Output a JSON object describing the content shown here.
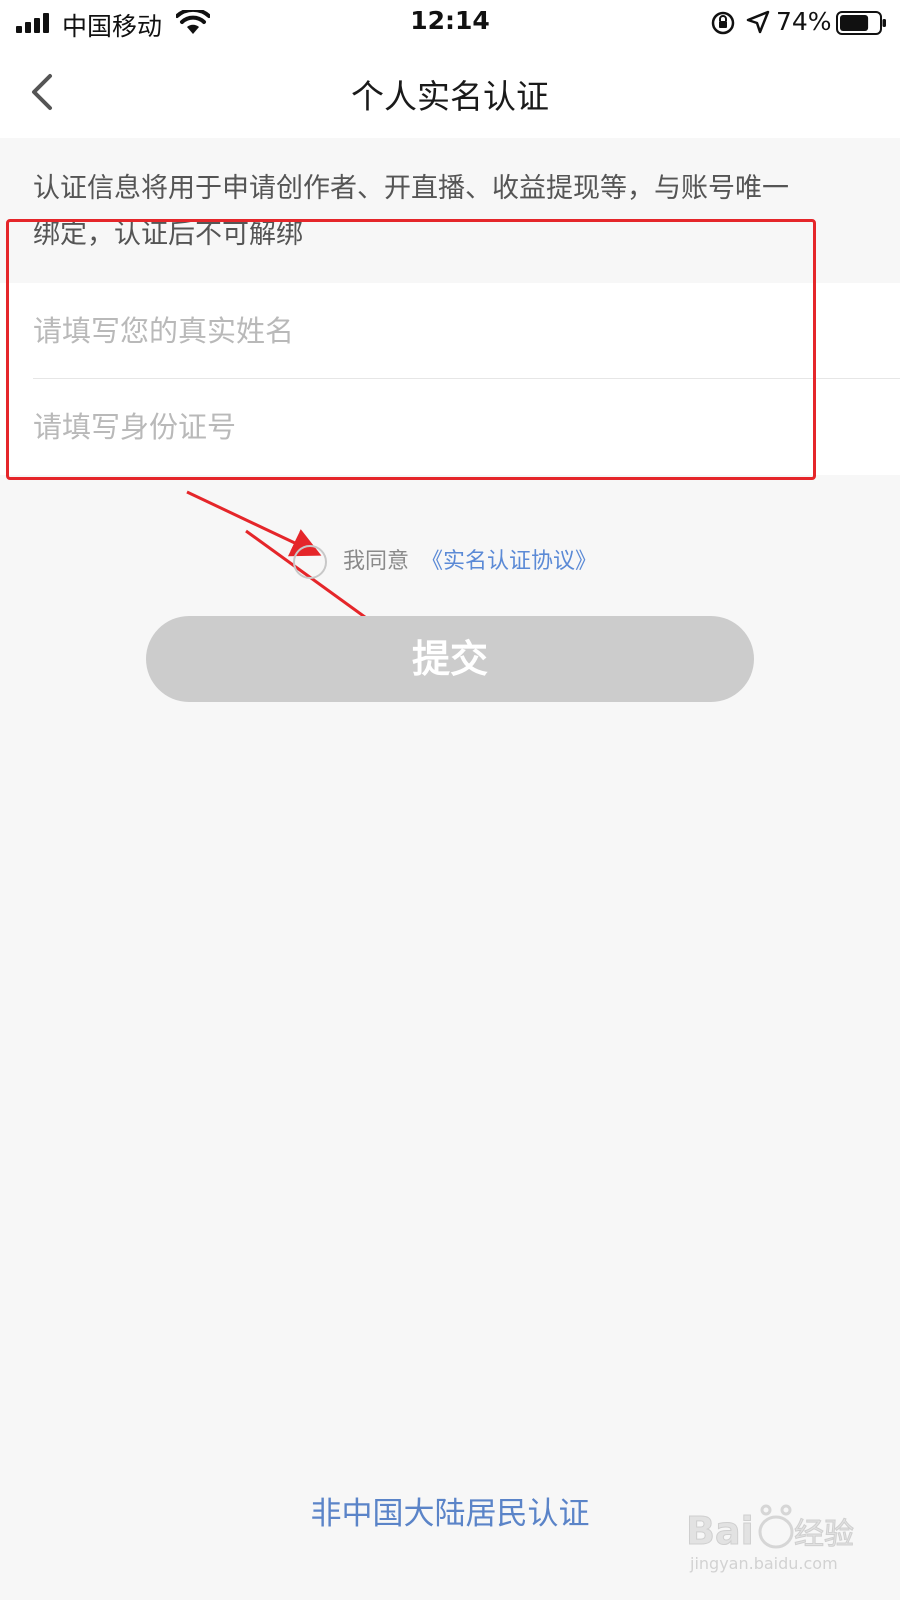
{
  "status_bar": {
    "carrier": "中国移动",
    "time": "12:14",
    "battery_percent": "74%",
    "battery_level": 0.74
  },
  "nav": {
    "title": "个人实名认证"
  },
  "description": {
    "line1": "认证信息将用于申请创作者、开直播、收益提现等，与账号唯一",
    "line2": "绑定，认证后不可解绑"
  },
  "form": {
    "name_placeholder": "请填写您的真实姓名",
    "id_placeholder": "请填写身份证号"
  },
  "agreement": {
    "prefix": "我同意",
    "link": "《实名认证协议》",
    "checked": false
  },
  "submit": {
    "label": "提交"
  },
  "footer": {
    "foreign_link": "非中国大陆居民认证"
  },
  "watermark": {
    "logo": "Baidu经验",
    "url": "jingyan.baidu.com"
  },
  "colors": {
    "annotation": "#e5262a",
    "link": "#5b8ad6",
    "submit_disabled": "#cccccc"
  }
}
